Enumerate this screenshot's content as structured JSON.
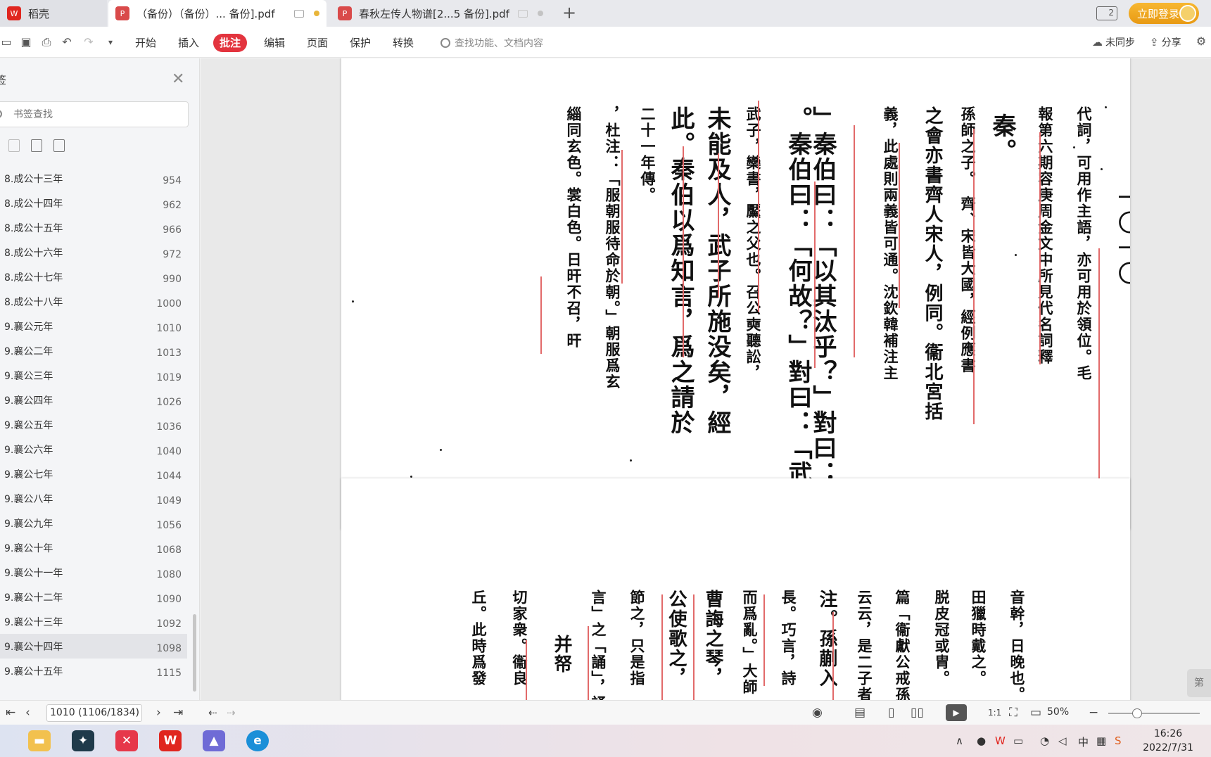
{
  "tabs": {
    "home_label": "稻壳",
    "active_label": "（备份）（备份）... 备份].pdf",
    "second_label": "春秋左传人物谱[2...5 备份].pdf",
    "add_label": "+"
  },
  "window": {
    "layout_label": "2",
    "login_label": "立即登录"
  },
  "toolbar": {
    "menus": [
      "开始",
      "插入",
      "批注",
      "编辑",
      "页面",
      "保护",
      "转换"
    ],
    "active_menu": "批注",
    "search_placeholder": "查找功能、文档内容",
    "sync_label": "未同步",
    "share_label": "分享"
  },
  "sidebar": {
    "title": "签",
    "search_placeholder": "书签查找",
    "bookmarks": [
      {
        "label": "8.成公十三年",
        "page": "954"
      },
      {
        "label": "8.成公十四年",
        "page": "962"
      },
      {
        "label": "8.成公十五年",
        "page": "966"
      },
      {
        "label": "8.成公十六年",
        "page": "972"
      },
      {
        "label": "8.成公十七年",
        "page": "990"
      },
      {
        "label": "8.成公十八年",
        "page": "1000"
      },
      {
        "label": "9.襄公元年",
        "page": "1010"
      },
      {
        "label": "9.襄公二年",
        "page": "1013"
      },
      {
        "label": "9.襄公三年",
        "page": "1019"
      },
      {
        "label": "9.襄公四年",
        "page": "1026"
      },
      {
        "label": "9.襄公五年",
        "page": "1036"
      },
      {
        "label": "9.襄公六年",
        "page": "1040"
      },
      {
        "label": "9.襄公七年",
        "page": "1044"
      },
      {
        "label": "9.襄公八年",
        "page": "1049"
      },
      {
        "label": "9.襄公九年",
        "page": "1056"
      },
      {
        "label": "9.襄公十年",
        "page": "1068"
      },
      {
        "label": "9.襄公十一年",
        "page": "1080"
      },
      {
        "label": "9.襄公十二年",
        "page": "1090"
      },
      {
        "label": "9.襄公十三年",
        "page": "1092"
      },
      {
        "label": "9.襄公十四年",
        "page": "1098"
      },
      {
        "label": "9.襄公十五年",
        "page": "1115"
      }
    ]
  },
  "document": {
    "page1_columns": [
      "代詞，可用作主語，亦可用於領位。毛",
      "報第六期容庚周金文中所見代名詞釋",
      "秦。",
      "孫師之子。　齊、宋皆大國，經例應書",
      "之會亦書齊人宋人，例同。衞北宮括",
      "義，此處則兩義皆可通。沈欽韓補注主",
      "」秦伯曰：「以其汰乎？」對曰：",
      "。秦伯曰：「何故？」對曰：「武",
      "武子，欒書，黶之父也。召公奭聽訟，",
      "未能及人，武子所施没矣，經",
      "此。秦伯以爲知言，爲之請於",
      "二十一年傳。",
      "，杜注：「服朝服待命於朝。」朝服爲玄",
      "緇同玄色。裳白色。日旰不召，旰"
    ],
    "page_number_mark": "一〇一〇",
    "page2_columns": [
      "音幹，日晚也。",
      "田獵時戴之。",
      "脱皮冠或胄。",
      "篇「衞獻公戒孫",
      "云云，是二子者",
      "注。孫蒯入",
      "長。巧言，詩",
      "而爲亂。」大師",
      "曹誨之琴，",
      "公使歌之，",
      "節之，只是指",
      "言」之「誦」，誦",
      "并帑",
      "切家衆。衞良",
      "丘。此時爲發"
    ]
  },
  "statusbar": {
    "page_field": "1010 (1106/1834)",
    "zoom": "50%",
    "fit_label": "1:1"
  },
  "side_tab": "第",
  "taskbar": {
    "ime_label": "中",
    "time": "16:26",
    "date": "2022/7/31"
  },
  "colors": {
    "accent_red": "#e3343e",
    "login_gold": "#f0a81f",
    "annotation_red": "#e26a6a"
  }
}
